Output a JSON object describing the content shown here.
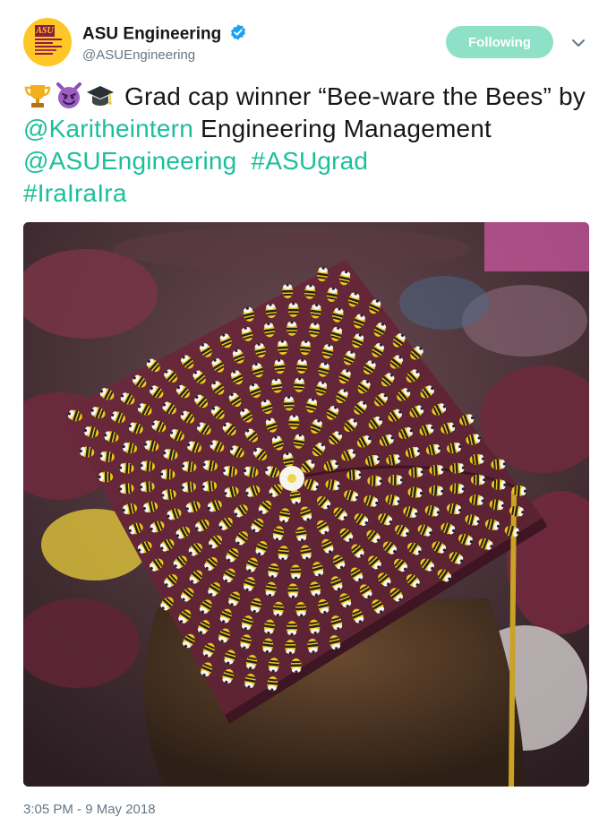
{
  "header": {
    "display_name": "ASU Engineering",
    "handle": "@ASUEngineering",
    "verified_icon": "verified-badge-icon",
    "follow_label": "Following",
    "avatar_logo_text": "ASU",
    "colors": {
      "follow_bg": "#8ee0c6",
      "verified": "#1da1f2",
      "brand_maroon": "#8c1d40",
      "brand_gold": "#ffc627"
    }
  },
  "tweet": {
    "emojis": [
      "trophy-icon",
      "smiling-imp-icon",
      "graduation-cap-icon"
    ],
    "text_1": "Grad cap winner “Bee-ware the Bees” by ",
    "mention_1": "@Karitheintern",
    "text_2": " Engineering Management ",
    "mention_2": "@ASUEngineering",
    "hashtag_1": "#ASUgrad",
    "hashtag_2": "#IraIraIra",
    "link_color": "#1cbf9a"
  },
  "media": {
    "icon": "photo-grad-cap-bees"
  },
  "footer": {
    "timestamp": "3:05 PM - 9 May 2018"
  }
}
